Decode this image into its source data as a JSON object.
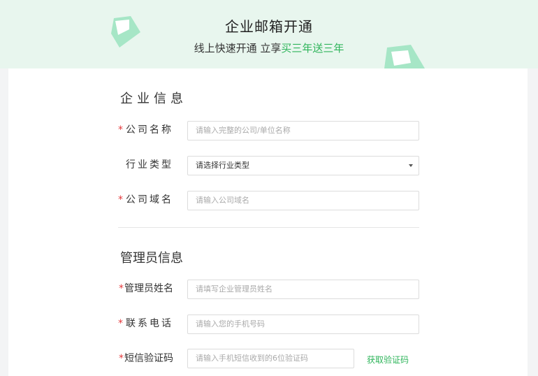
{
  "banner": {
    "title": "企业邮箱开通",
    "subtitle_prefix": "线上快速开通 立享",
    "subtitle_highlight": "买三年送三年",
    "accent_color": "#2fb55b"
  },
  "company_section": {
    "title": "企业信息",
    "fields": {
      "name": {
        "required": "*",
        "label": "公司名称",
        "placeholder": "请输入完整的公司/单位名称"
      },
      "industry": {
        "label": "行业类型",
        "value": "请选择行业类型",
        "icon": "chevron-down-icon"
      },
      "domain": {
        "required": "*",
        "label": "公司域名",
        "placeholder": "请输入公司域名"
      }
    }
  },
  "admin_section": {
    "title": "管理员信息",
    "fields": {
      "name": {
        "required": "*",
        "label": "管理员姓名",
        "placeholder": "请填写企业管理员姓名"
      },
      "phone": {
        "required": "*",
        "label": "联系电话",
        "placeholder": "请输入您的手机号码"
      },
      "sms": {
        "required": "*",
        "label": "短信验证码",
        "placeholder": "请输入手机短信收到的6位验证码",
        "button": "获取验证码"
      }
    }
  }
}
